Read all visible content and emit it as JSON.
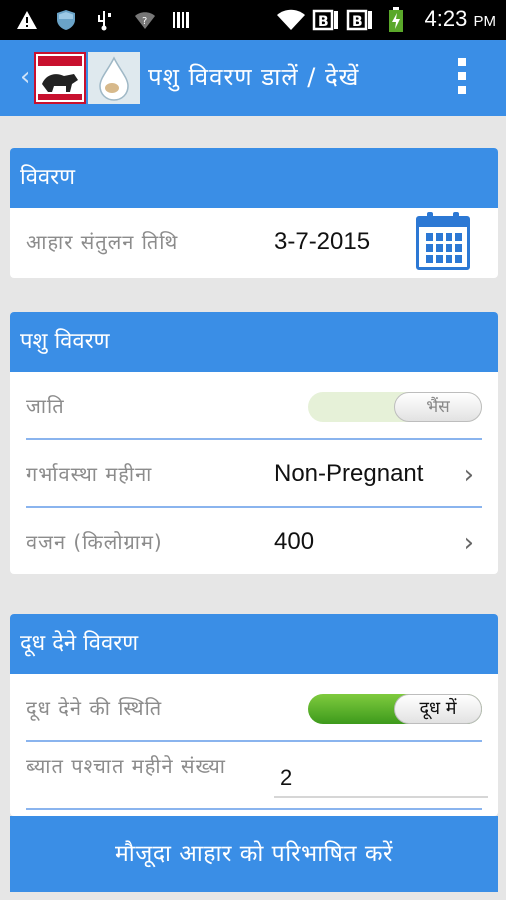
{
  "status_bar": {
    "time": "4:23",
    "ampm": "PM"
  },
  "action_bar": {
    "title": "पशु विवरण डालें / देखें",
    "icons": [
      "back-arrow-icon",
      "logo-icon",
      "overflow-menu-icon"
    ]
  },
  "details_card": {
    "header": "विवरण",
    "date_label": "आहार संतुलन तिथि",
    "date_value": "3-7-2015"
  },
  "animal_card": {
    "header": "पशु विवरण",
    "breed_label": "जाति",
    "breed_toggle": "भैंस",
    "pregnancy_label": "गर्भावस्था महीना",
    "pregnancy_value": "Non-Pregnant",
    "weight_label": "वजन (किलोग्राम)",
    "weight_value": "400"
  },
  "milk_card": {
    "header": "दूध देने विवरण",
    "status_label": "दूध देने की स्थिति",
    "status_toggle": "दूध में",
    "months_label": "ब्यात पश्चात महीने संख्या",
    "months_value": "2"
  },
  "bottom_button": "मौजूदा आहार को परिभाषित करें",
  "colors": {
    "accent": "#3a8ee6",
    "divider": "#8ab4ee",
    "toggle_on": "#5cb82a",
    "background": "#e6e6e6"
  }
}
